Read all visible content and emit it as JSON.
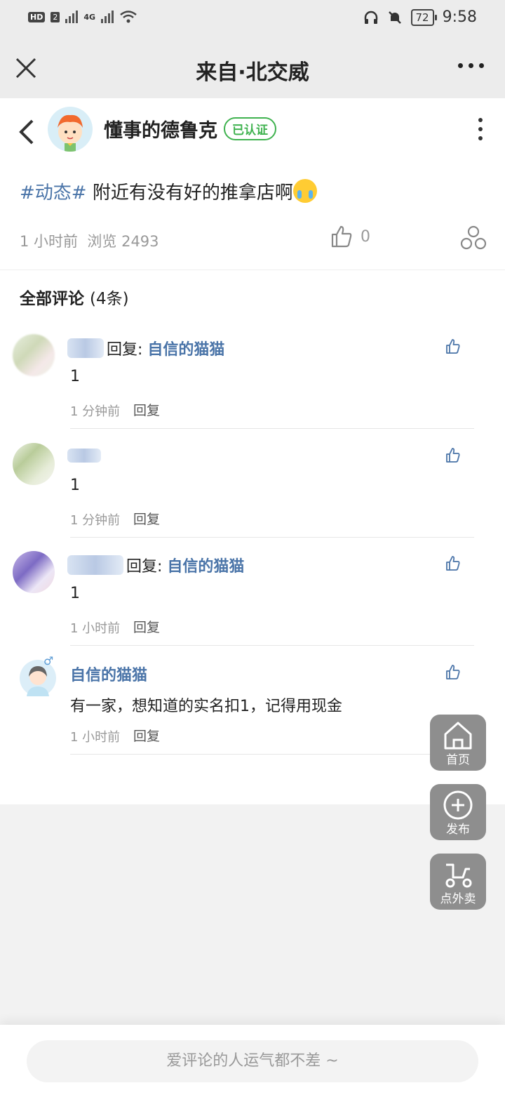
{
  "status_bar": {
    "hd": "HD",
    "sim": "2",
    "net": "4G",
    "battery": "72",
    "time": "9:58"
  },
  "header": {
    "title": "来自·北交威"
  },
  "post": {
    "author": "懂事的德鲁克",
    "badge": "已认证",
    "tag": "#动态#",
    "text": " 附近有没有好的推拿店啊",
    "time": "1 小时前",
    "views": "浏览 2493",
    "likes": "0"
  },
  "comments_header": {
    "label": "全部评论",
    "count": "(4条)"
  },
  "comments": [
    {
      "reply_prefix": "回复:",
      "reply_to": "自信的猫猫",
      "text": "1",
      "time": "1 分钟前",
      "reply_label": "回复"
    },
    {
      "text": "1",
      "time": "1 分钟前",
      "reply_label": "回复"
    },
    {
      "reply_prefix": "回复:",
      "reply_to": "自信的猫猫",
      "text": "1",
      "time": "1 小时前",
      "reply_label": "回复"
    },
    {
      "name": "自信的猫猫",
      "gender": "♂",
      "text": "有一家，想知道的实名扣1，记得用现金",
      "time": "1 小时前",
      "reply_label": "回复"
    }
  ],
  "fabs": {
    "home": "首页",
    "publish": "发布",
    "takeout": "点外卖"
  },
  "input": {
    "placeholder": "爱评论的人运气都不差 ~"
  },
  "colors": {
    "link_blue": "#4a74a8",
    "verified_green": "#3fb24f",
    "fab_gray": "#8e8e8e"
  },
  "icons": [
    "close-icon",
    "more-icon",
    "back-icon",
    "like-icon",
    "share-icon",
    "home-icon",
    "plus-icon",
    "scooter-icon"
  ]
}
